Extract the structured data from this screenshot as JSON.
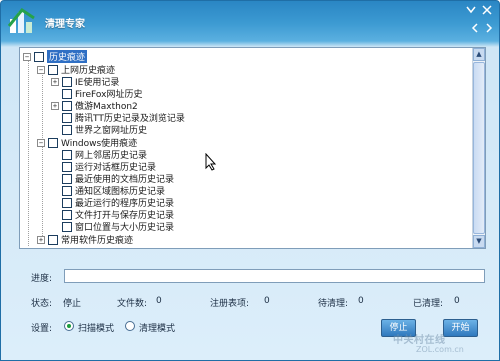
{
  "window": {
    "title": "清理专家",
    "controls": [
      "minimize-icon",
      "close-icon"
    ],
    "nav": [
      "back-icon",
      "forward-icon"
    ]
  },
  "tree": {
    "root": {
      "label": "历史痕迹",
      "expanded": true,
      "selected": true
    },
    "nodes": [
      {
        "label": "上网历史痕迹",
        "expanded": true
      },
      {
        "label": "IE使用记录",
        "expander": "+"
      },
      {
        "label": "FireFox网址历史"
      },
      {
        "label": "傲游Maxthon2",
        "expander": "+"
      },
      {
        "label": "腾讯TT历史记录及浏览记录"
      },
      {
        "label": "世界之窗网址历史"
      },
      {
        "label": "Windows使用痕迹",
        "expanded": true
      },
      {
        "label": "网上邻居历史记录"
      },
      {
        "label": "运行对话框历史记录"
      },
      {
        "label": "最近使用的文档历史记录"
      },
      {
        "label": "通知区域图标历史记录"
      },
      {
        "label": "最近运行的程序历史记录"
      },
      {
        "label": "文件打开与保存历史记录"
      },
      {
        "label": "窗口位置与大小历史记录"
      },
      {
        "label": "常用软件历史痕迹",
        "expander": "+"
      }
    ]
  },
  "progress": {
    "label": "进度:",
    "value": 0
  },
  "status": {
    "state_label": "状态:",
    "state_value": "停止",
    "files_label": "文件数:",
    "files_value": "0",
    "registry_label": "注册表项:",
    "registry_value": "0",
    "pending_label": "待清理:",
    "pending_value": "0",
    "cleaned_label": "已清理:",
    "cleaned_value": "0"
  },
  "settings": {
    "label": "设置:",
    "options": [
      {
        "label": "扫描模式",
        "checked": true
      },
      {
        "label": "清理模式",
        "checked": false
      }
    ]
  },
  "buttons": {
    "stop": "停止",
    "start": "开始"
  },
  "watermark": {
    "main": "中关村在线",
    "sub": "ZOL.com.cn"
  }
}
